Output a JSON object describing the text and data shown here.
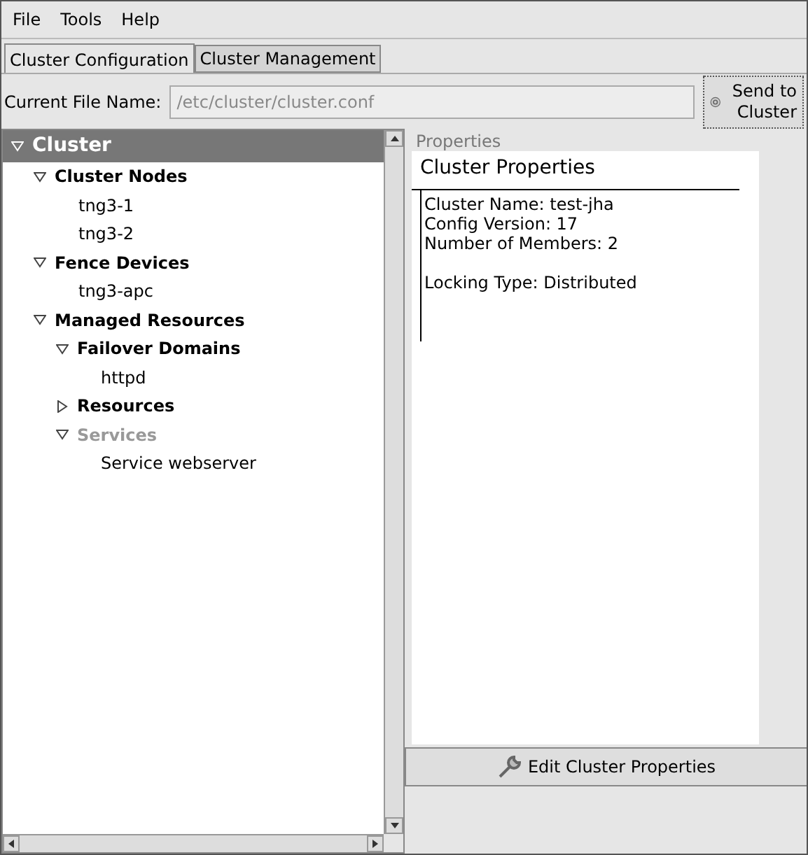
{
  "menu": [
    "File",
    "Tools",
    "Help"
  ],
  "tabs": [
    {
      "label": "Cluster Configuration",
      "selected": true
    },
    {
      "label": "Cluster Management",
      "selected": false
    }
  ],
  "file_row": {
    "label": "Current File Name:",
    "value": "/etc/cluster/cluster.conf",
    "button": "Send to Cluster"
  },
  "tree": [
    {
      "label": "Cluster",
      "expanded": true,
      "selected": true,
      "disabled": false,
      "children": [
        {
          "label": "Cluster Nodes",
          "expanded": true,
          "selected": false,
          "disabled": false,
          "children": [
            {
              "label": "tng3-1",
              "selected": false,
              "disabled": false
            },
            {
              "label": "tng3-2",
              "selected": false,
              "disabled": false
            }
          ]
        },
        {
          "label": "Fence Devices",
          "expanded": true,
          "selected": false,
          "disabled": false,
          "children": [
            {
              "label": "tng3-apc",
              "selected": false,
              "disabled": false
            }
          ]
        },
        {
          "label": "Managed Resources",
          "expanded": true,
          "selected": false,
          "disabled": false,
          "children": [
            {
              "label": "Failover Domains",
              "expanded": true,
              "selected": false,
              "disabled": false,
              "children": [
                {
                  "label": "httpd",
                  "selected": false,
                  "disabled": false
                }
              ]
            },
            {
              "label": "Resources",
              "expanded": false,
              "selected": false,
              "disabled": false
            },
            {
              "label": "Services",
              "expanded": true,
              "selected": false,
              "disabled": true,
              "children": [
                {
                  "label": "Service webserver",
                  "selected": false,
                  "disabled": false
                }
              ]
            }
          ]
        }
      ]
    }
  ],
  "properties": {
    "group_label": "Properties",
    "title": "Cluster Properties",
    "line_groups": [
      [
        "Cluster Name: test-jha",
        "Config Version: 17",
        "Number of Members: 2"
      ],
      [
        "Locking Type: Distributed"
      ]
    ],
    "button": "Edit Cluster Properties"
  }
}
